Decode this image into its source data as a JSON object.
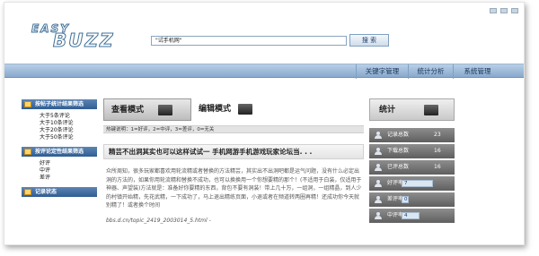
{
  "logo": {
    "line1": "EASY",
    "line2": "BUZZ"
  },
  "search": {
    "value": "\"试手机网\"",
    "button_label": "搜 索"
  },
  "nav": {
    "items": [
      "关键字管理",
      "统计分析",
      "系统管理"
    ]
  },
  "sidebar": {
    "sections": [
      {
        "title": "按帖子统计结果筛选",
        "items": [
          "大于5条评论",
          "大于10条评论",
          "大于20条评论",
          "大于50条评论"
        ]
      },
      {
        "title": "按评论定性结果筛选",
        "items": [
          "好评",
          "中评",
          "差评"
        ]
      },
      {
        "title": "记录状态",
        "items": []
      }
    ]
  },
  "modes": {
    "view_label": "查看模式",
    "edit_label": "编辑模式"
  },
  "hint": "热键说明：1=好评，2=中评，3=差评，0=无关",
  "post": {
    "title": "精芸不出洞其实也可以这样试试一 手机网游手机游戏玩家论坛当. . .",
    "body": "众所周知，很多玩家都喜欢用轮流精或者替换的方法精芸，其实出不出洞吧都是运气问题，没有什么必定出洞的方法的，如果你用轮流精和替换不成功，也可以换换用一个你想要精的那个！(不适用于白装，仅适用于神器、声望装)方法就是：准备好你要精的东西，背包不要有洞装！带上几十万，一组洞，一组精晶，到人少的村镇开始精，先花武精，一下成功了，马上退出精练页面，小退或者在频道转两圈再精！还成功你今天就别精了！或者换个时间",
    "url": "bbs.d.cn/topic_2419_2003014_5.html -"
  },
  "stats": {
    "title": "统计",
    "rows": [
      {
        "label": "记录总数",
        "value": "23"
      },
      {
        "label": "下载总数",
        "value": "16"
      },
      {
        "label": "已评总数",
        "value": "16"
      },
      {
        "label": "好评率",
        "value": "7"
      },
      {
        "label": "差评率",
        "value": "0"
      },
      {
        "label": "中评率",
        "value": "4"
      }
    ],
    "bar_fractions": [
      null,
      null,
      null,
      0.7,
      0.1,
      0.4
    ]
  }
}
